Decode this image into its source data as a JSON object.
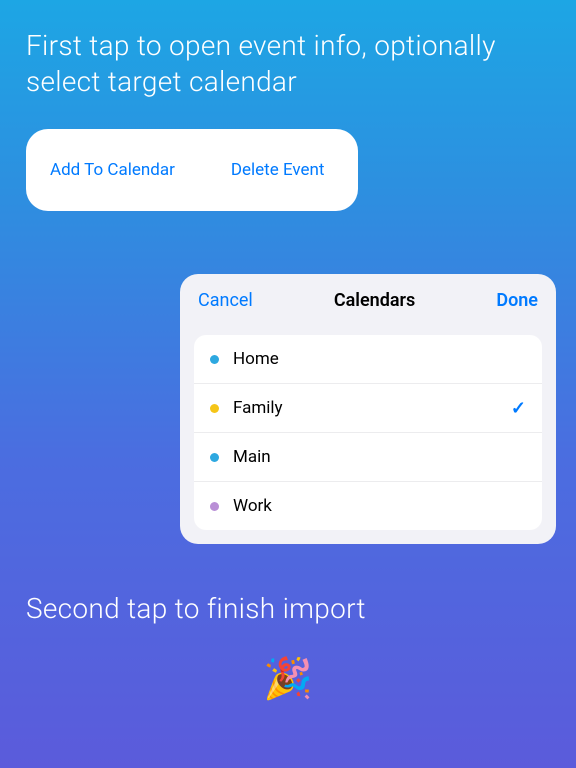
{
  "heading1": "First tap to open event info, optionally select target calendar",
  "actions": {
    "add": "Add To Calendar",
    "delete": "Delete Event"
  },
  "picker": {
    "cancel": "Cancel",
    "title": "Calendars",
    "done": "Done",
    "items": [
      {
        "label": "Home",
        "dot": "#2DA8E0",
        "selected": false
      },
      {
        "label": "Family",
        "dot": "#F5C518",
        "selected": true
      },
      {
        "label": "Main",
        "dot": "#2DA8E0",
        "selected": false
      },
      {
        "label": "Work",
        "dot": "#B98FD6",
        "selected": false
      }
    ]
  },
  "heading2": "Second tap to finish import",
  "emoji": "🎉"
}
